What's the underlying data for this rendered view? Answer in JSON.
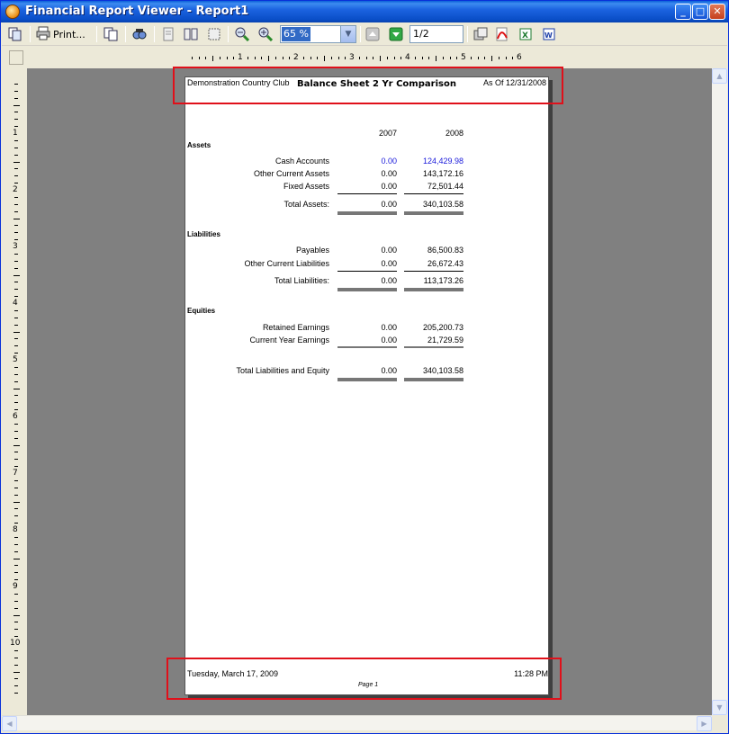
{
  "window": {
    "title": "Financial Report Viewer - Report1",
    "controls": {
      "minimize": "_",
      "maximize": "□",
      "close": "✕"
    }
  },
  "toolbar": {
    "print_label": "Print...",
    "zoom_value": "65 %",
    "page_value": "1/2",
    "icons": [
      "copy-icon",
      "print-icon",
      "multi-page-icon",
      "find-icon",
      "single-page-icon",
      "two-page-icon",
      "page-setup-icon",
      "zoom-out-icon",
      "zoom-in-icon",
      "previous-page-icon",
      "next-page-icon",
      "export-icon",
      "pdf-icon",
      "excel-icon",
      "word-icon"
    ]
  },
  "ruler": {
    "horizontal_numbers": [
      "1",
      "2",
      "3",
      "4",
      "5",
      "6"
    ],
    "vertical_numbers": [
      "1",
      "2",
      "3",
      "4",
      "5",
      "6",
      "7",
      "8",
      "9",
      "10"
    ]
  },
  "report": {
    "header": {
      "company": "Demonstration Country Club",
      "title": "Balance Sheet 2 Yr Comparison",
      "as_of": "As Of 12/31/2008"
    },
    "years": [
      "2007",
      "2008"
    ],
    "assets": {
      "heading": "Assets",
      "rows": [
        {
          "label": "Cash Accounts",
          "y2007": "0.00",
          "y2008": "124,429.98"
        },
        {
          "label": "Other Current Assets",
          "y2007": "0.00",
          "y2008": "143,172.16"
        },
        {
          "label": "Fixed Assets",
          "y2007": "0.00",
          "y2008": "72,501.44"
        }
      ],
      "total": {
        "label": "Total Assets:",
        "y2007": "0.00",
        "y2008": "340,103.58"
      }
    },
    "liabilities": {
      "heading": "Liabilities",
      "rows": [
        {
          "label": "Payables",
          "y2007": "0.00",
          "y2008": "86,500.83"
        },
        {
          "label": "Other Current Liabilities",
          "y2007": "0.00",
          "y2008": "26,672.43"
        }
      ],
      "total": {
        "label": "Total Liabilities:",
        "y2007": "0.00",
        "y2008": "113,173.26"
      }
    },
    "equities": {
      "heading": "Equities",
      "rows": [
        {
          "label": "Retained Earnings",
          "y2007": "0.00",
          "y2008": "205,200.73"
        },
        {
          "label": "Current Year Earnings",
          "y2007": "0.00",
          "y2008": "21,729.59"
        }
      ]
    },
    "grand_total": {
      "label": "Total Liabilities and Equity",
      "y2007": "0.00",
      "y2008": "340,103.58"
    },
    "footer": {
      "date": "Tuesday, March 17, 2009",
      "time": "11:28 PM",
      "page": "Page 1"
    }
  },
  "colors": {
    "highlight": "#e0101a",
    "link_blue": "#1a1adb",
    "canvas": "#808080"
  }
}
